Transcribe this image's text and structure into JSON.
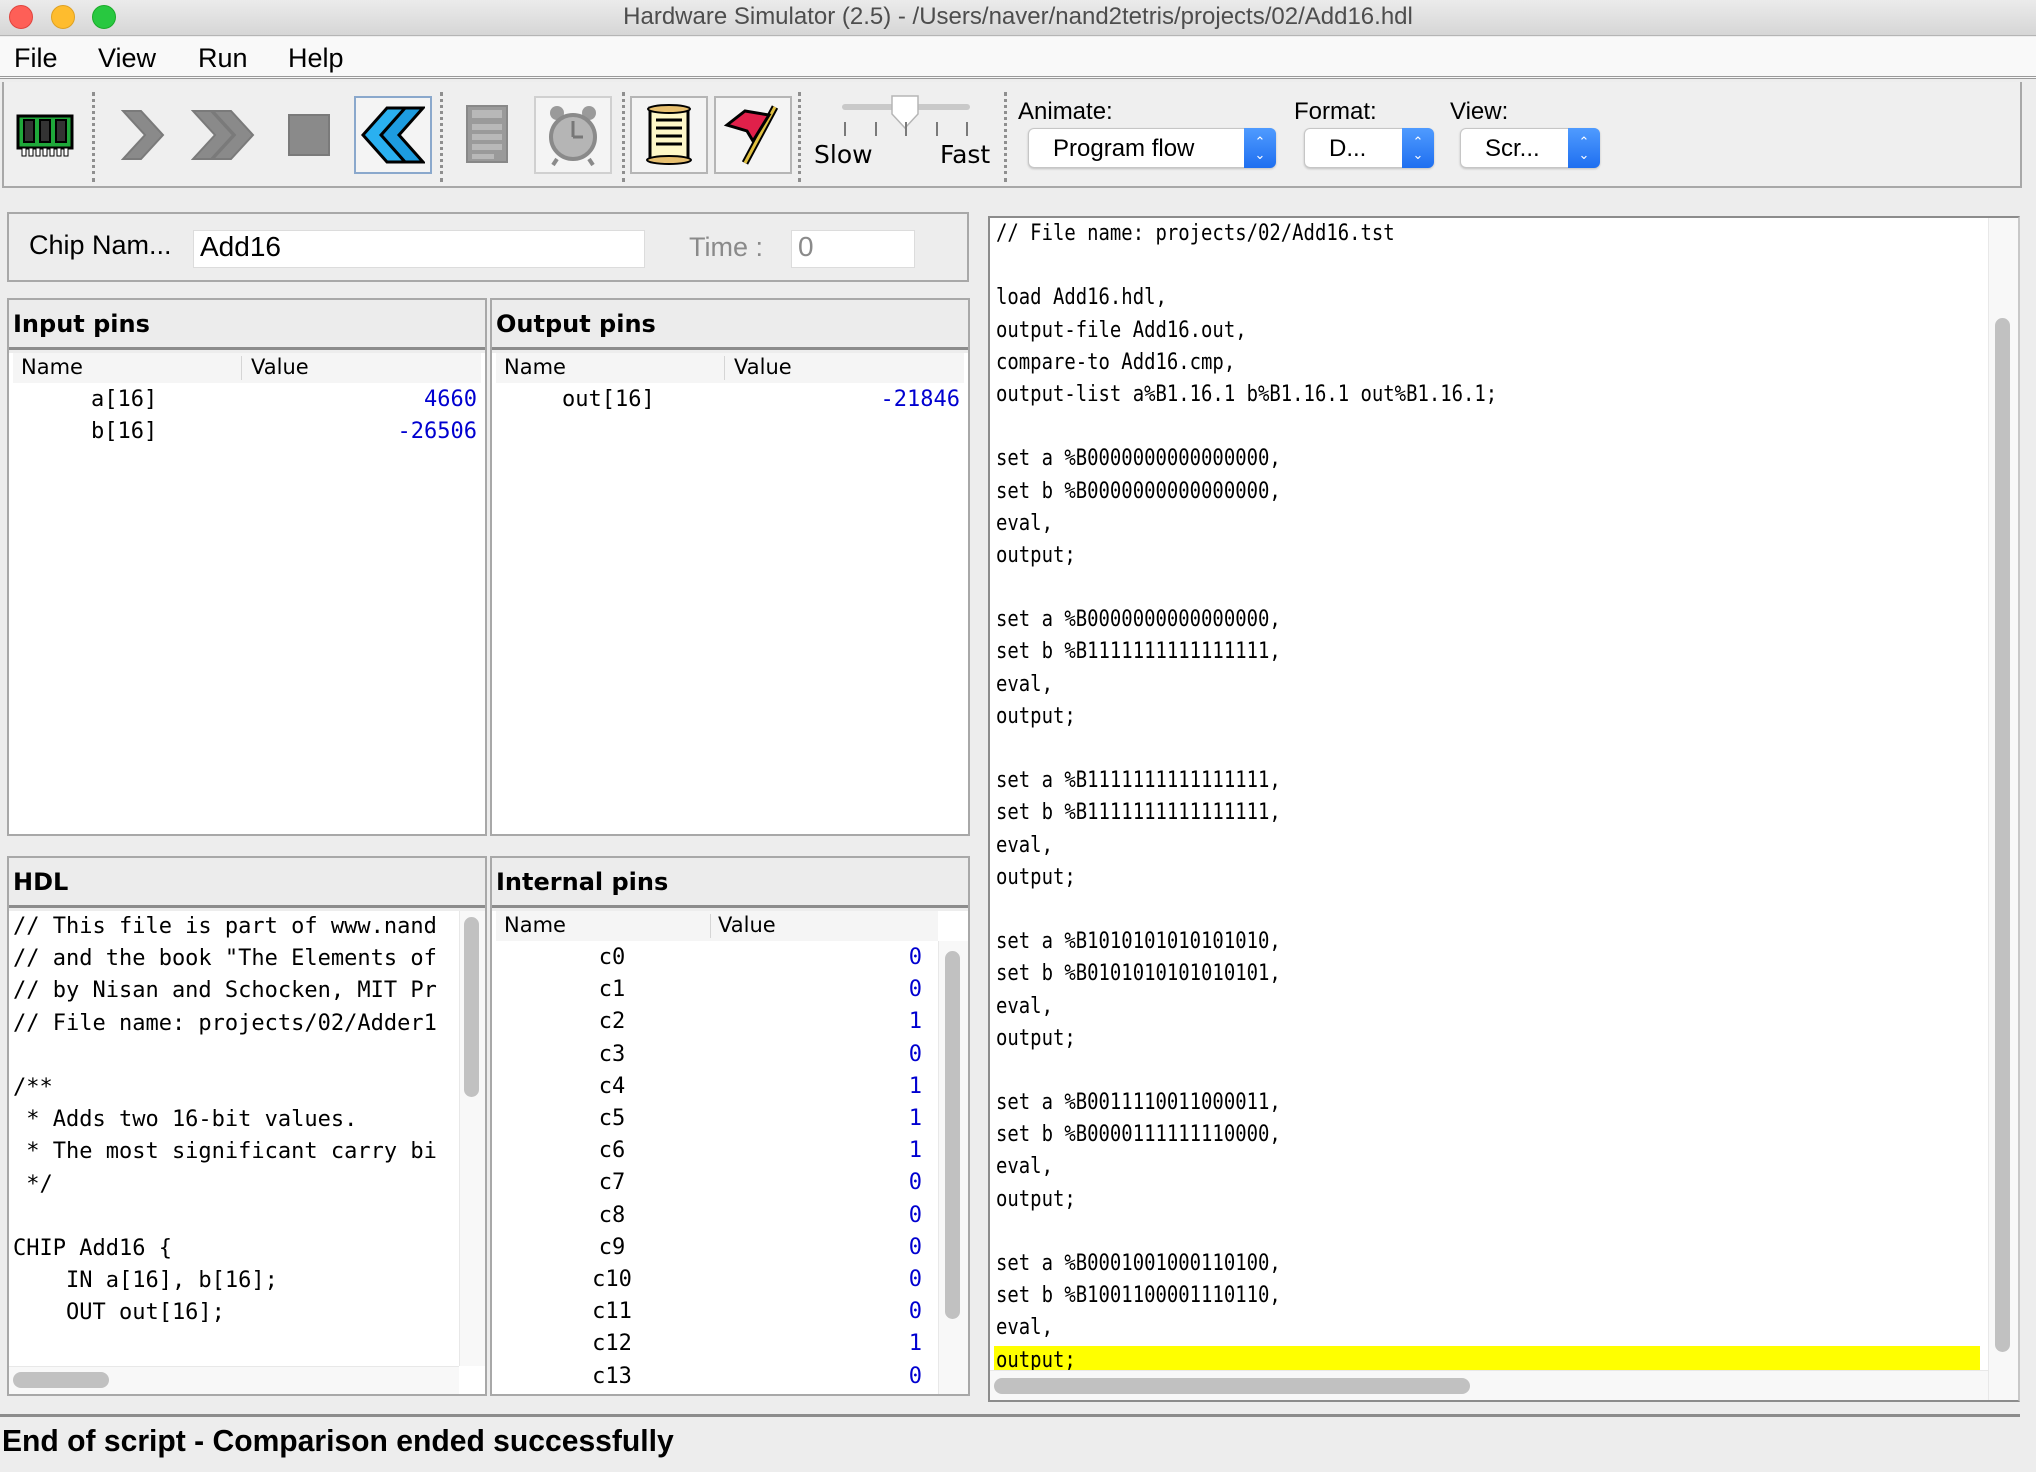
{
  "window": {
    "title": "Hardware Simulator (2.5) - /Users/naver/nand2tetris/projects/02/Add16.hdl"
  },
  "menu": [
    "File",
    "View",
    "Run",
    "Help"
  ],
  "toolbar": {
    "buttons": [
      {
        "name": "load-chip",
        "icon": "chip-icon",
        "enabled": true
      },
      {
        "name": "single-step",
        "icon": "chevron-right-icon",
        "enabled": false
      },
      {
        "name": "run",
        "icon": "double-chevron-right-icon",
        "enabled": false
      },
      {
        "name": "stop",
        "icon": "stop-icon",
        "enabled": false
      },
      {
        "name": "reset",
        "icon": "double-chevron-left-icon",
        "enabled": true,
        "selected": true
      },
      {
        "name": "eval",
        "icon": "calculator-icon",
        "enabled": false
      },
      {
        "name": "tick-tock",
        "icon": "alarm-clock-icon",
        "enabled": false
      },
      {
        "name": "load-script",
        "icon": "scroll-icon",
        "enabled": true
      },
      {
        "name": "breakpoints",
        "icon": "flag-icon",
        "enabled": true
      }
    ],
    "speed": {
      "label_slow": "Slow",
      "label_fast": "Fast",
      "ticks": 5,
      "position_fraction": 0.5
    },
    "animate": {
      "label": "Animate:",
      "value": "Program flow"
    },
    "format": {
      "label": "Format:",
      "value": "D..."
    },
    "view": {
      "label": "View:",
      "value": "Scr..."
    }
  },
  "chip": {
    "name_label": "Chip Nam...",
    "name_value": "Add16",
    "time_label": "Time :",
    "time_value": "0"
  },
  "input_pins": {
    "title": "Input pins",
    "columns": [
      "Name",
      "Value"
    ],
    "rows": [
      {
        "name": "a[16]",
        "value": "4660"
      },
      {
        "name": "b[16]",
        "value": "-26506"
      }
    ]
  },
  "output_pins": {
    "title": "Output pins",
    "columns": [
      "Name",
      "Value"
    ],
    "rows": [
      {
        "name": "out[16]",
        "value": "-21846"
      }
    ]
  },
  "hdl": {
    "title": "HDL",
    "lines": [
      "// This file is part of www.nand",
      "// and the book \"The Elements of",
      "// by Nisan and Schocken, MIT Pr",
      "// File name: projects/02/Adder1",
      "",
      "/**",
      " * Adds two 16-bit values.",
      " * The most significant carry bi",
      " */",
      "",
      "CHIP Add16 {",
      "    IN a[16], b[16];",
      "    OUT out[16];"
    ]
  },
  "internal_pins": {
    "title": "Internal pins",
    "columns": [
      "Name",
      "Value"
    ],
    "rows": [
      {
        "name": "c0",
        "value": "0"
      },
      {
        "name": "c1",
        "value": "0"
      },
      {
        "name": "c2",
        "value": "1"
      },
      {
        "name": "c3",
        "value": "0"
      },
      {
        "name": "c4",
        "value": "1"
      },
      {
        "name": "c5",
        "value": "1"
      },
      {
        "name": "c6",
        "value": "1"
      },
      {
        "name": "c7",
        "value": "0"
      },
      {
        "name": "c8",
        "value": "0"
      },
      {
        "name": "c9",
        "value": "0"
      },
      {
        "name": "c10",
        "value": "0"
      },
      {
        "name": "c11",
        "value": "0"
      },
      {
        "name": "c12",
        "value": "1"
      },
      {
        "name": "c13",
        "value": "0"
      }
    ]
  },
  "script": {
    "highlighted_line": 36,
    "lines": [
      "// File name: projects/02/Add16.tst",
      "",
      "load Add16.hdl,",
      "output-file Add16.out,",
      "compare-to Add16.cmp,",
      "output-list a%B1.16.1 b%B1.16.1 out%B1.16.1;",
      "",
      "set a %B0000000000000000,",
      "set b %B0000000000000000,",
      "eval,",
      "output;",
      "",
      "set a %B0000000000000000,",
      "set b %B1111111111111111,",
      "eval,",
      "output;",
      "",
      "set a %B1111111111111111,",
      "set b %B1111111111111111,",
      "eval,",
      "output;",
      "",
      "set a %B1010101010101010,",
      "set b %B0101010101010101,",
      "eval,",
      "output;",
      "",
      "set a %B0011110011000011,",
      "set b %B0000111111110000,",
      "eval,",
      "output;",
      "",
      "set a %B0001001000110100,",
      "set b %B1001100001110110,",
      "eval,",
      "output;"
    ]
  },
  "status": {
    "message": "End of script - Comparison ended successfully"
  },
  "colors": {
    "highlight": "#ffff00",
    "pin_value": "#0000d0",
    "select_accent": "#1f6ff0"
  }
}
